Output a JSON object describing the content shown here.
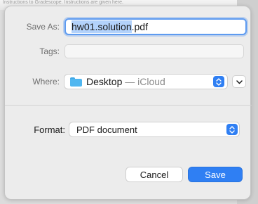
{
  "background": {
    "text": "Instructions to Gradescope. Instructions are given here."
  },
  "dialog": {
    "save_as_label": "Save As:",
    "filename_selected": "hw01.solution",
    "filename_ext": ".pdf",
    "tags_label": "Tags:",
    "tags_value": "",
    "where_label": "Where:",
    "where_folder": "Desktop",
    "where_location": " — iCloud",
    "format_label": "Format:",
    "format_value": "PDF document",
    "cancel_label": "Cancel",
    "save_label": "Save"
  },
  "colors": {
    "accent": "#2f7ff3",
    "selection": "#b3d2fb",
    "folder": "#4fb6f0"
  },
  "icons": {
    "where_stepper": "up-down-chevron-icon",
    "expand": "chevron-down-icon",
    "format_stepper": "up-down-chevron-icon",
    "folder": "folder-icon"
  }
}
